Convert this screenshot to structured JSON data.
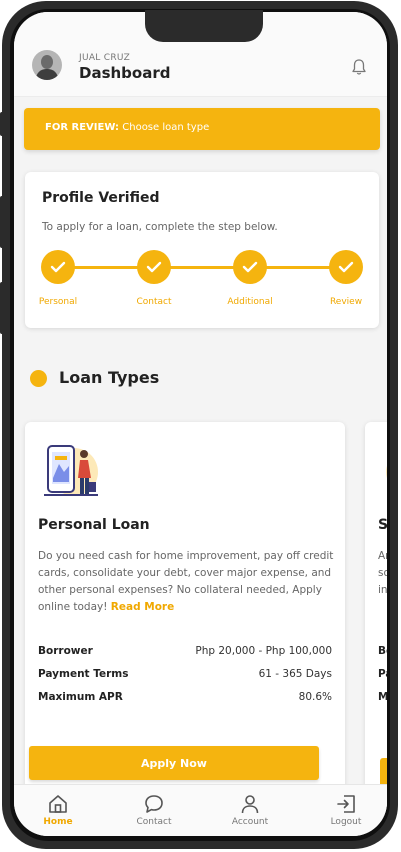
{
  "header": {
    "username": "JUAL CRUZ",
    "title": "Dashboard"
  },
  "banner": {
    "prefix": "FOR REVIEW:",
    "text": "Choose loan type"
  },
  "profile": {
    "title": "Profile Verified",
    "description": "To apply for a loan, complete the step below.",
    "steps": [
      {
        "label": "Personal"
      },
      {
        "label": "Contact"
      },
      {
        "label": "Additional"
      },
      {
        "label": "Review"
      }
    ]
  },
  "section": {
    "title": "Loan Types"
  },
  "loan": {
    "title": "Personal Loan",
    "description": "Do you need cash for home improvement, pay off credit cards, consolidate your debt, cover major expense, and other personal expenses? No collateral needed, Apply online today!",
    "read_more": "Read More",
    "rows": [
      {
        "key": "Borrower",
        "value": "Php 20,000 - Php 100,000"
      },
      {
        "key": "Payment Terms",
        "value": "61 - 365 Days"
      },
      {
        "key": "Maximum APR",
        "value": "80.6%"
      }
    ],
    "apply_label": "Apply Now"
  },
  "loan_partial": {
    "title": "Sa",
    "lines": [
      "Ar",
      "so",
      "ins"
    ],
    "rows": [
      "Bo",
      "Pa",
      "M"
    ]
  },
  "nav": [
    {
      "label": "Home",
      "icon": "home-icon"
    },
    {
      "label": "Contact",
      "icon": "chat-icon"
    },
    {
      "label": "Account",
      "icon": "user-icon"
    },
    {
      "label": "Logout",
      "icon": "logout-icon"
    }
  ],
  "colors": {
    "accent": "#f5b40f",
    "accent_text": "#f0a800"
  }
}
